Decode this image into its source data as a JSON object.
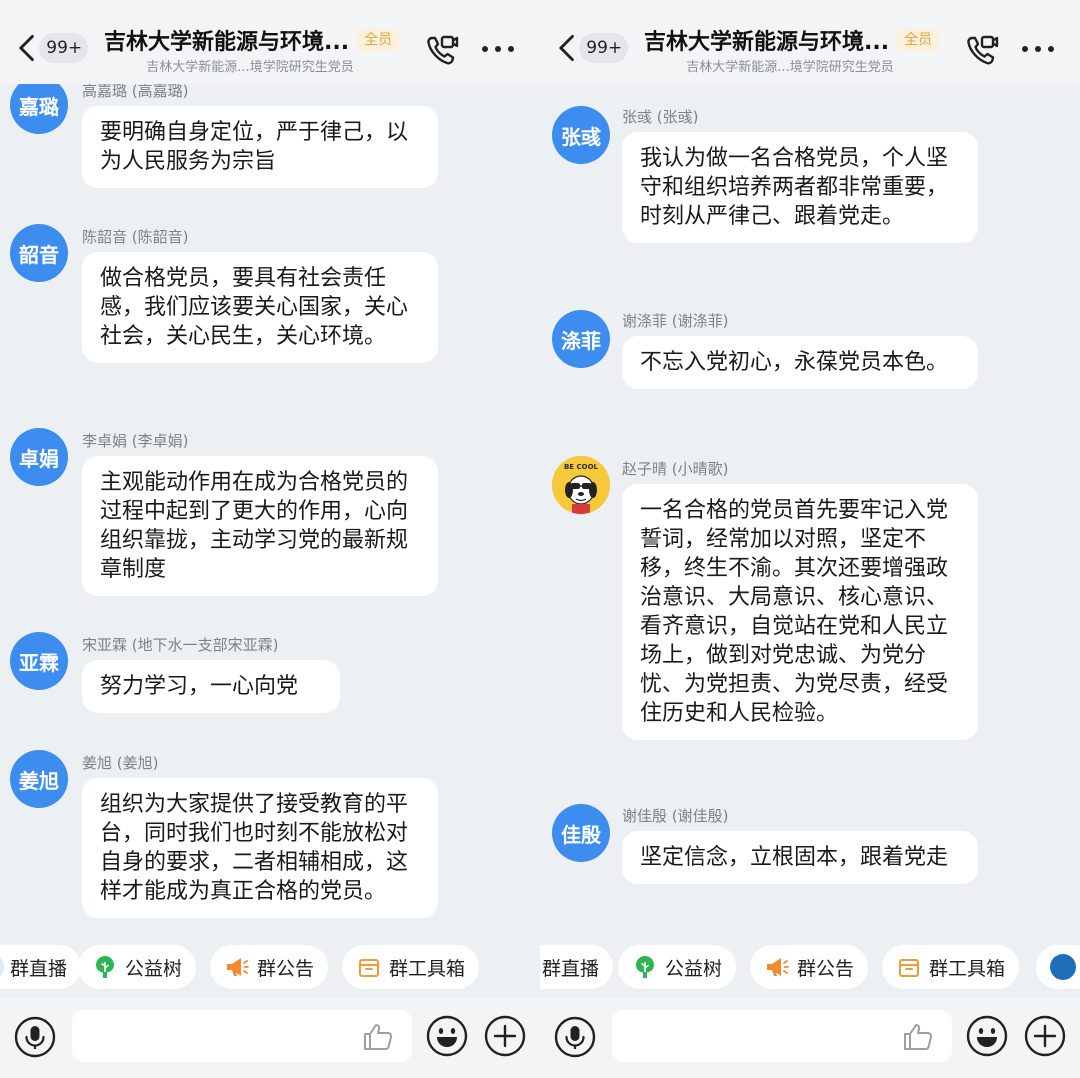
{
  "screens": [
    {
      "header": {
        "badge": "99+",
        "title": "吉林大学新能源与环境...",
        "tag": "全员",
        "subtitle": "吉林大学新能源...境学院研究生党员"
      },
      "messages": [
        {
          "avatar": "嘉璐",
          "sender": "高嘉璐 (高嘉璐)",
          "text": "要明确自身定位，严于律己，以为人民服务为宗旨"
        },
        {
          "avatar": "韶音",
          "sender": "陈韶音 (陈韶音)",
          "text": "做合格党员，要具有社会责任感，我们应该要关心国家，关心社会，关心民生，关心环境。"
        },
        {
          "avatar": "卓娟",
          "sender": "李卓娟 (李卓娟)",
          "text": "主观能动作用在成为合格党员的过程中起到了更大的作用，心向组织靠拢，主动学习党的最新规章制度"
        },
        {
          "avatar": "亚霖",
          "sender": "宋亚霖 (地下水一支部宋亚霖)",
          "text": "努力学习，一心向党"
        },
        {
          "avatar": "姜旭",
          "sender": "姜旭 (姜旭)",
          "text": "组织为大家提供了接受教育的平台，同时我们也时刻不能放松对自身的要求，二者相辅相成，这样才能成为真正合格的党员。"
        }
      ],
      "quick_actions": [
        "群直播",
        "公益树",
        "群公告",
        "群工具箱"
      ],
      "input": {
        "placeholder": ""
      }
    },
    {
      "header": {
        "badge": "99+",
        "title": "吉林大学新能源与环境...",
        "tag": "全员",
        "subtitle": "吉林大学新能源...境学院研究生党员"
      },
      "messages": [
        {
          "avatar": "张彧",
          "sender": "张彧 (张彧)",
          "text": "我认为做一名合格党员，个人坚守和组织培养两者都非常重要，时刻从严律己、跟着党走。"
        },
        {
          "avatar": "涤菲",
          "sender": "谢涤菲 (谢涤菲)",
          "text": "不忘入党初心，永葆党员本色。"
        },
        {
          "avatar": "",
          "avatar_image": "be-cool-dog-icon",
          "avatar_caption": "BE COOL",
          "sender": "赵子晴 (小晴歌)",
          "text": "一名合格的党员首先要牢记入党誓词，经常加以对照，坚定不移，终生不渝。其次还要增强政治意识、大局意识、核心意识、看齐意识，自觉站在党和人民立场上，做到对党忠诚、为党分忧、为党担责、为党尽责，经受住历史和人民检验。"
        },
        {
          "avatar": "佳殷",
          "sender": "谢佳殷 (谢佳殷)",
          "text": "坚定信念，立根固本，跟着党走"
        }
      ],
      "quick_actions": [
        "群直播",
        "公益树",
        "群公告",
        "群工具箱"
      ],
      "input": {
        "placeholder": ""
      }
    }
  ],
  "colors": {
    "avatar_blue": "#3d8df0",
    "tag_bg": "#fdf1db",
    "tag_text": "#e0a43e",
    "tree_green": "#2fb454",
    "announce_orange": "#f28a2e",
    "toolbox_orange": "#f29a3a"
  }
}
